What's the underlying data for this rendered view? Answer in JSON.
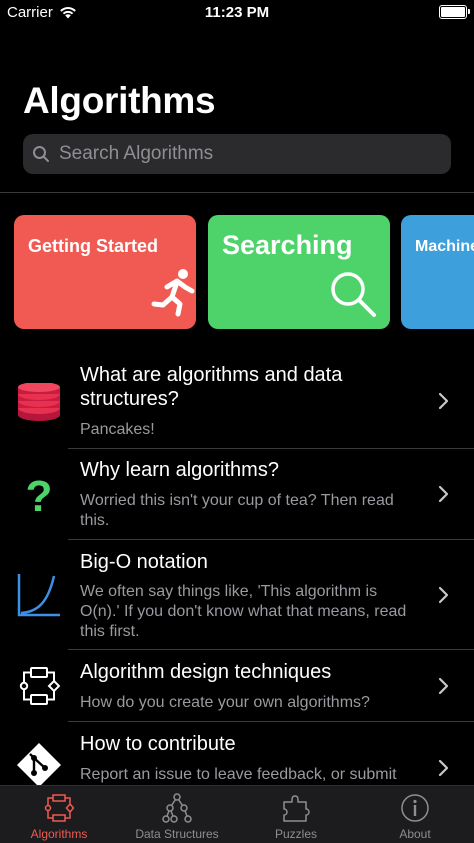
{
  "status_bar": {
    "carrier": "Carrier",
    "time": "11:23 PM"
  },
  "header": {
    "title": "Algorithms"
  },
  "search": {
    "placeholder": "Search Algorithms"
  },
  "categories": [
    {
      "label": "Getting Started",
      "color": "#f05a52",
      "icon": "running-person-icon"
    },
    {
      "label": "Searching",
      "color": "#4ed36a",
      "icon": "magnifier-icon"
    },
    {
      "label": "Machine",
      "color": "#3d9fdc"
    }
  ],
  "list": [
    {
      "title": "What are algorithms and data structures?",
      "subtitle": "Pancakes!",
      "icon": "pancakes-icon"
    },
    {
      "title": "Why learn algorithms?",
      "subtitle": "Worried this isn't your cup of tea? Then read this.",
      "icon": "question-mark-icon"
    },
    {
      "title": "Big-O notation",
      "subtitle": "We often say things like, 'This algorithm is O(n).' If you don't know what that means, read this first.",
      "icon": "growth-curve-icon"
    },
    {
      "title": "Algorithm design techniques",
      "subtitle": "How do you create your own algorithms?",
      "icon": "flowchart-icon"
    },
    {
      "title": "How to contribute",
      "subtitle": "Report an issue to leave feedback, or submit",
      "icon": "git-icon"
    }
  ],
  "tabs": [
    {
      "label": "Algorithms",
      "active": true
    },
    {
      "label": "Data Structures",
      "active": false
    },
    {
      "label": "Puzzles",
      "active": false
    },
    {
      "label": "About",
      "active": false
    }
  ],
  "colors": {
    "accent": "#f05a52",
    "secondary_text": "#9a9aa0",
    "background": "#000000"
  }
}
